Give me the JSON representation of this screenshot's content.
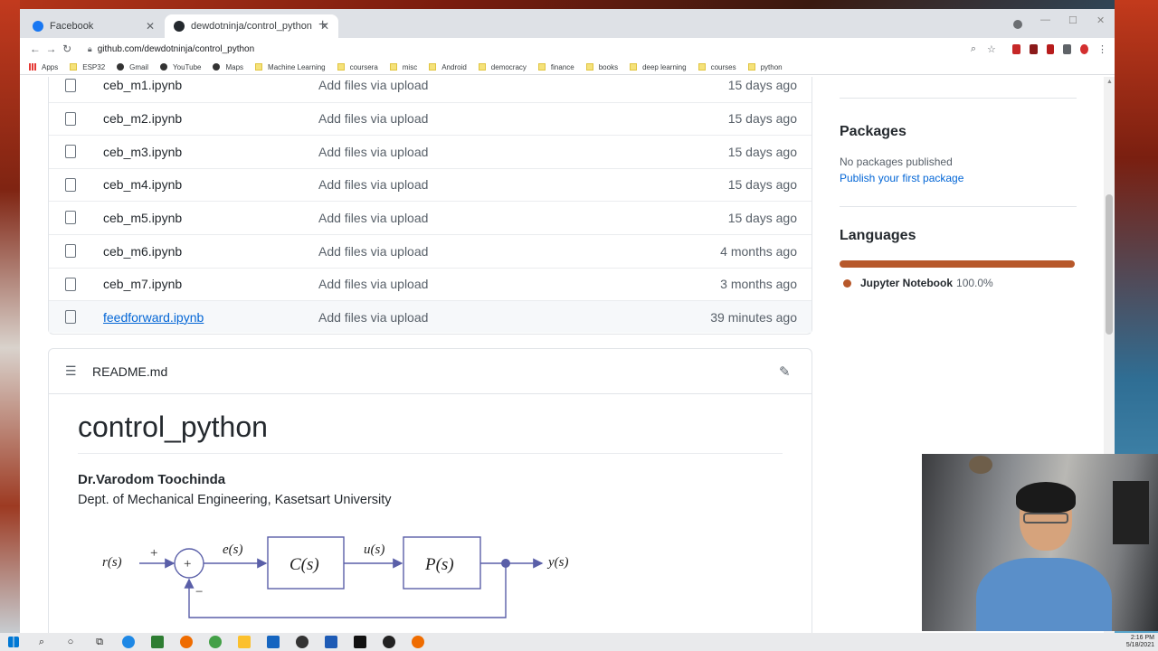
{
  "browser": {
    "tabs": [
      {
        "label": "Facebook",
        "active": false
      },
      {
        "label": "dewdotninja/control_python",
        "active": true
      }
    ],
    "url": "github.com/dewdotninja/control_python",
    "bookmarks": [
      "Apps",
      "ESP32",
      "Gmail",
      "YouTube",
      "Maps",
      "Machine Learning",
      "coursera",
      "misc",
      "Android",
      "democracy",
      "finance",
      "books",
      "deep learning",
      "courses",
      "python"
    ]
  },
  "files": [
    {
      "name": "ceb_m1.ipynb",
      "message": "Add files via upload",
      "age": "15 days ago"
    },
    {
      "name": "ceb_m2.ipynb",
      "message": "Add files via upload",
      "age": "15 days ago"
    },
    {
      "name": "ceb_m3.ipynb",
      "message": "Add files via upload",
      "age": "15 days ago"
    },
    {
      "name": "ceb_m4.ipynb",
      "message": "Add files via upload",
      "age": "15 days ago"
    },
    {
      "name": "ceb_m5.ipynb",
      "message": "Add files via upload",
      "age": "15 days ago"
    },
    {
      "name": "ceb_m6.ipynb",
      "message": "Add files via upload",
      "age": "4 months ago"
    },
    {
      "name": "ceb_m7.ipynb",
      "message": "Add files via upload",
      "age": "3 months ago"
    },
    {
      "name": "feedforward.ipynb",
      "message": "Add files via upload",
      "age": "39 minutes ago"
    }
  ],
  "readme": {
    "filename": "README.md",
    "title": "control_python",
    "author": "Dr.Varodom Toochinda",
    "dept": "Dept. of Mechanical Engineering, Kasetsart University",
    "diagram": {
      "r": "r(s)",
      "plus": "+",
      "e": "e(s)",
      "sum": "+",
      "minus": "−",
      "C": "C(s)",
      "u": "u(s)",
      "P": "P(s)",
      "y": "y(s)"
    }
  },
  "sidebar": {
    "packages_title": "Packages",
    "packages_text": "No packages published",
    "packages_link": "Publish your first package",
    "languages_title": "Languages",
    "language_name": "Jupyter Notebook",
    "language_pct": "100.0%",
    "language_color": "#b7582a"
  },
  "taskbar": {
    "time": "2:16 PM",
    "date": "5/18/2021"
  }
}
